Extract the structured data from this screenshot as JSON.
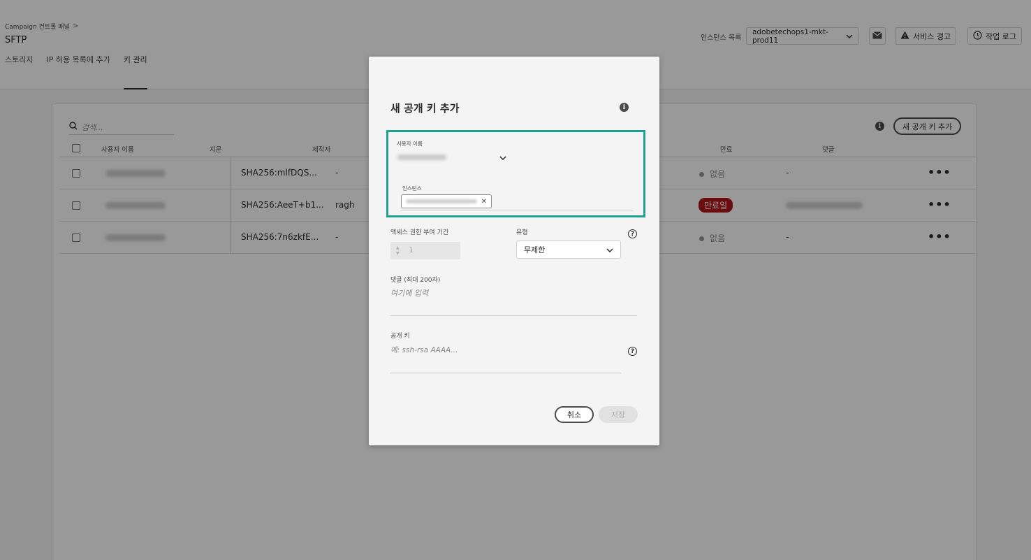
{
  "header": {
    "breadcrumb": "Campaign 컨트롤 패널",
    "breadcrumb_chevron": ">",
    "title": "SFTP",
    "tabs": [
      {
        "label": "스토리지"
      },
      {
        "label": "IP 허용 목록에 추가"
      },
      {
        "label": "키 관리"
      }
    ],
    "instance_list_label": "인스턴스 목록",
    "instance_selected": "adobetechops1-mkt-prod11",
    "service_alert_label": "서비스 경고",
    "job_log_label": "작업 로그"
  },
  "card": {
    "search_placeholder": "검색...",
    "add_key_button": "새 공개 키 추가",
    "columns": {
      "username": "사용자 이름",
      "fingerprint": "지문",
      "creator": "제작자",
      "expiry": "만료",
      "comment": "댓글"
    },
    "rows": [
      {
        "fingerprint": "SHA256:mlfDQS...",
        "creator": "-",
        "expiry": "없음",
        "expired": false,
        "comment": "-"
      },
      {
        "fingerprint": "SHA256:AeeT+b1...",
        "creator": "ragh",
        "expiry": "만료일",
        "expired": true,
        "comment": ""
      },
      {
        "fingerprint": "SHA256:7n6zkfE...",
        "creator": "-",
        "expiry": "없음",
        "expired": false,
        "comment": "-"
      }
    ],
    "more_glyph": "•••"
  },
  "modal": {
    "title": "새 공개 키 추가",
    "username_label": "사용자 이름",
    "instance_label": "인스턴스",
    "access_duration_label": "액세스 권한 부여 기간",
    "access_duration_value": "1",
    "type_label": "유형",
    "type_value": "무제한",
    "comment_label": "댓글 (최대 200자)",
    "comment_placeholder": "여기에 입력",
    "public_key_label": "공개 키",
    "public_key_placeholder": "예: ssh-rsa AAAA...",
    "cancel_button": "취소",
    "save_button": "저장",
    "highlight_color": "#1aa391"
  }
}
